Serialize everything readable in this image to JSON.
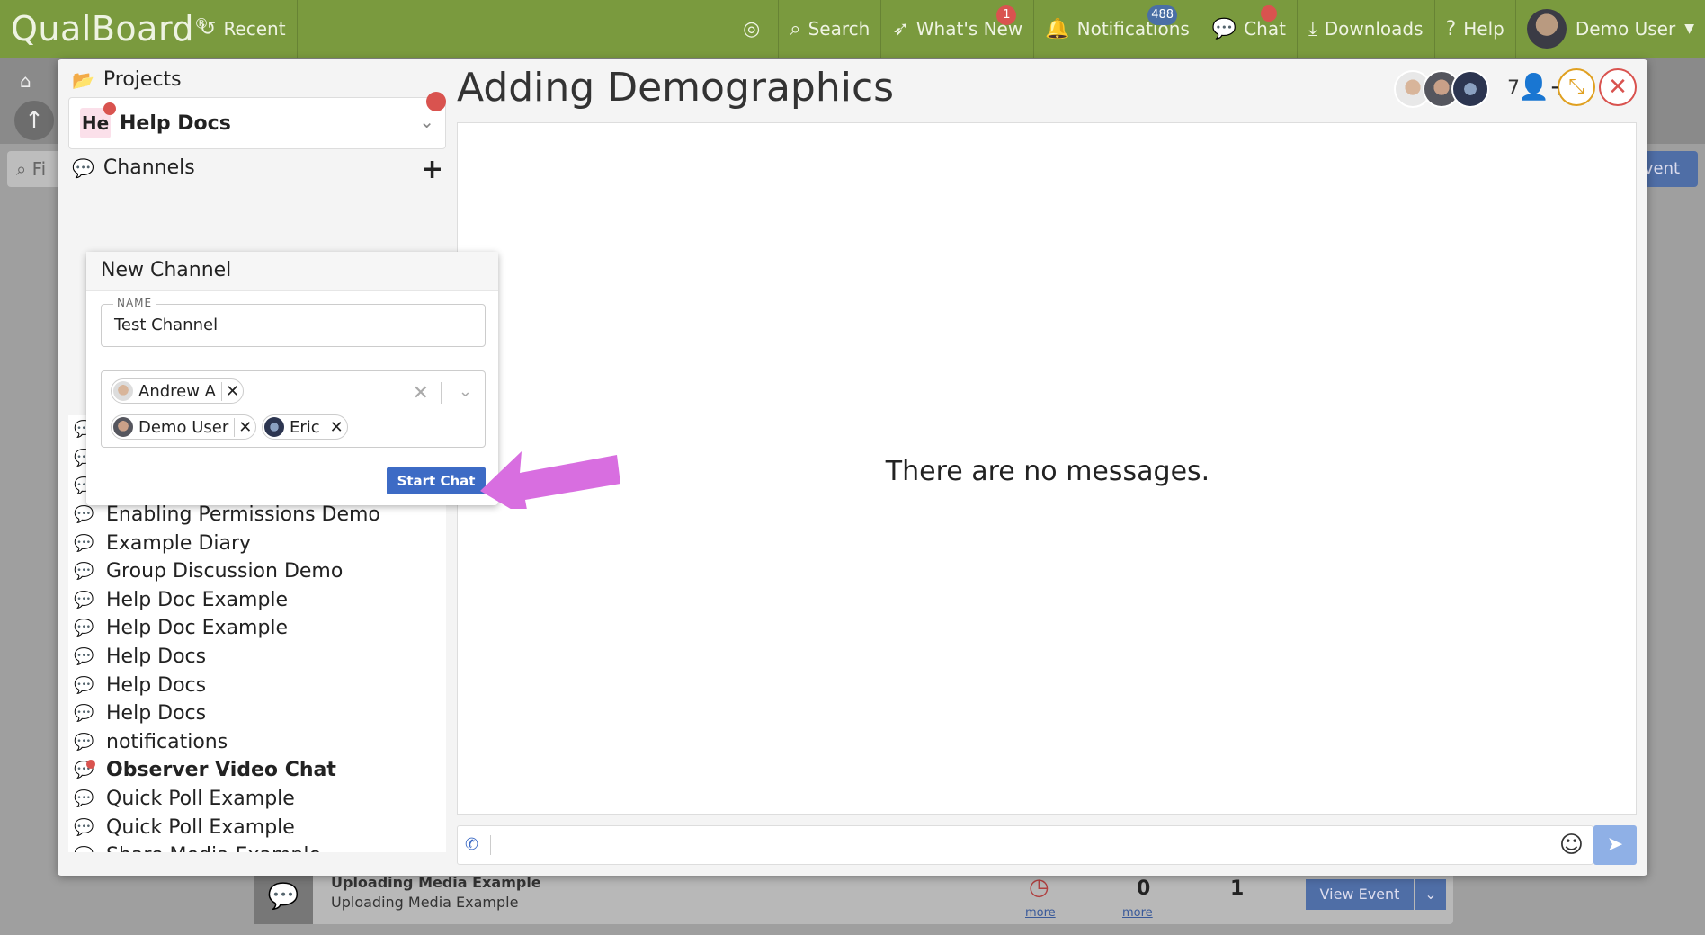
{
  "app": {
    "logo": "QualBoard",
    "nav": {
      "recent": "Recent",
      "search": "Search",
      "whats_new": "What's New",
      "whats_new_badge": "1",
      "notifications": "Notifications",
      "notifications_badge": "488",
      "chat": "Chat",
      "downloads": "Downloads",
      "help": "Help",
      "user": "Demo User"
    }
  },
  "background": {
    "filter_placeholder": "Fi",
    "event_button": "vent",
    "row": {
      "title": "Uploading Media Example",
      "subtitle": "Uploading Media Example",
      "more1": "more",
      "count": "0",
      "more2": "more",
      "count2": "1",
      "view_event": "View Event"
    }
  },
  "chat": {
    "projects_label": "Projects",
    "project": {
      "abbr": "He",
      "name": "Help Docs"
    },
    "channels_label": "Channels",
    "channels": [
      {
        "name": "Enabling Permissions Demo",
        "unread": false
      },
      {
        "name": "Enabling Permissions Demo",
        "unread": false
      },
      {
        "name": "Enabling Permissions Demo",
        "unread": false
      },
      {
        "name": "Enabling Permissions Demo",
        "unread": false
      },
      {
        "name": "Example Diary",
        "unread": false
      },
      {
        "name": "Group Discussion Demo",
        "unread": false
      },
      {
        "name": "Help Doc Example",
        "unread": false
      },
      {
        "name": "Help Doc Example",
        "unread": false
      },
      {
        "name": "Help Docs",
        "unread": false
      },
      {
        "name": "Help Docs",
        "unread": false
      },
      {
        "name": "Help Docs",
        "unread": false
      },
      {
        "name": "notifications",
        "unread": false
      },
      {
        "name": "Observer Video Chat",
        "unread": true
      },
      {
        "name": "Quick Poll Example",
        "unread": false
      },
      {
        "name": "Quick Poll Example",
        "unread": false
      },
      {
        "name": "Share Media Example",
        "unread": false
      }
    ],
    "new_channel": {
      "title": "New Channel",
      "name_legend": "NAME",
      "name_value": "Test Channel",
      "members": [
        "Andrew A",
        "Demo User",
        "Eric"
      ],
      "start_button": "Start Chat"
    },
    "conversation": {
      "title": "Adding Demographics",
      "participant_count": "7",
      "empty_text": "There are no messages.",
      "compose_placeholder": ""
    }
  },
  "colors": {
    "topbar": "#7a9a3e",
    "accent_blue": "#3d6bc5",
    "badge_red": "#d9534f",
    "callout_magenta": "#d86ee0"
  }
}
